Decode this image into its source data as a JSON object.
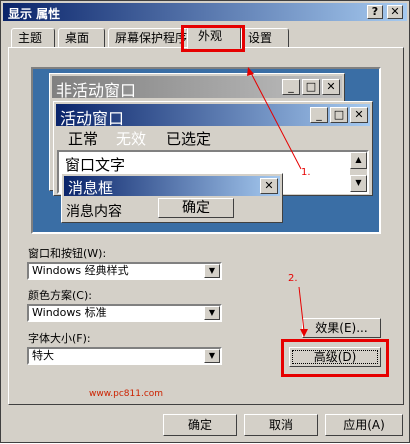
{
  "window": {
    "title": "显示 属性",
    "help_btn": "?",
    "close_btn": "✕"
  },
  "tabs": [
    {
      "label": "主题"
    },
    {
      "label": "桌面"
    },
    {
      "label": "屏幕保护程序"
    },
    {
      "label": "外观"
    },
    {
      "label": "设置"
    }
  ],
  "preview": {
    "inactive_title": "非活动窗口",
    "active_title": "活动窗口",
    "menu": {
      "normal": "正常",
      "disabled": "无效",
      "selected": "已选定"
    },
    "window_text": "窗口文字",
    "msgbox_title": "消息框",
    "msgbox_text": "消息内容",
    "ok": "确定",
    "min_glyph": "_",
    "max_glyph": "□",
    "close_glyph": "✕",
    "scroll_up": "▲",
    "scroll_down": "▼"
  },
  "form": {
    "style_label": "窗口和按钮(W):",
    "style_value": "Windows 经典样式",
    "scheme_label": "颜色方案(C):",
    "scheme_value": "Windows 标准",
    "fontsize_label": "字体大小(F):",
    "fontsize_value": "特大",
    "dropdown_glyph": "▼"
  },
  "buttons": {
    "effects": "效果(E)...",
    "advanced": "高级(D)",
    "ok": "确定",
    "cancel": "取消",
    "apply": "应用(A)"
  },
  "annotations": {
    "step1": "1.",
    "step2": "2.",
    "watermark": "www.pc811.com"
  },
  "colors": {
    "annotation_red": "#e60000",
    "desktop_blue": "#3a6ea5",
    "active_title": "#0a246a",
    "inactive_title": "#808080"
  }
}
